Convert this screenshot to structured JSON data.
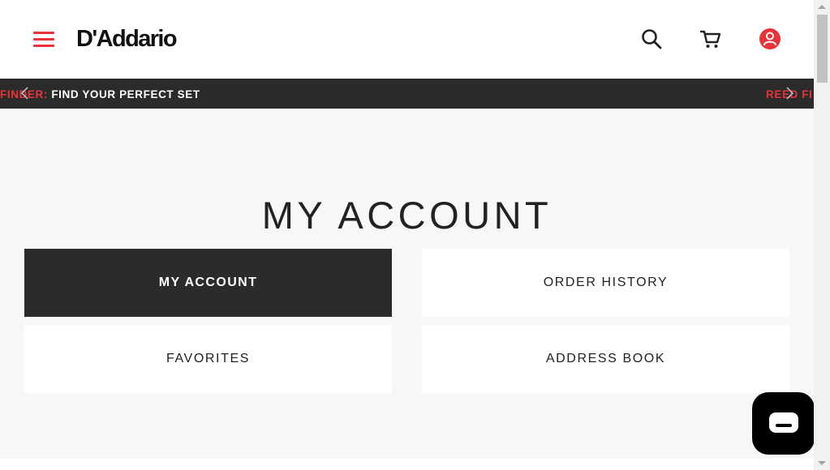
{
  "header": {
    "logo_text": "D'Addario",
    "icons": [
      "hamburger-menu-icon",
      "search-icon",
      "cart-icon",
      "account-icon"
    ],
    "accent_color": "#e8333a"
  },
  "promo": {
    "left_accent": "FINDER:",
    "left_text": "FIND YOUR PERFECT SET",
    "right_accent": "REED FI",
    "bar_color": "#2b2b2b"
  },
  "main": {
    "title": "MY ACCOUNT",
    "tiles": [
      {
        "label": "MY ACCOUNT",
        "active": true
      },
      {
        "label": "ORDER HISTORY",
        "active": false
      },
      {
        "label": "FAVORITES",
        "active": false
      },
      {
        "label": "ADDRESS BOOK",
        "active": false
      }
    ]
  },
  "chat": {
    "icon": "chat-bubble-icon"
  }
}
